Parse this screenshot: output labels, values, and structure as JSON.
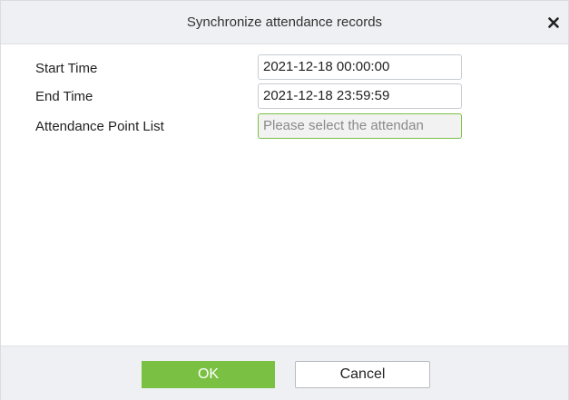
{
  "dialog": {
    "title": "Synchronize attendance records",
    "close_icon": "close-icon"
  },
  "form": {
    "start_time": {
      "label": "Start Time",
      "value": "2021-12-18 00:00:00"
    },
    "end_time": {
      "label": "End Time",
      "value": "2021-12-18 23:59:59"
    },
    "attendance_point_list": {
      "label": "Attendance Point List",
      "placeholder": "Please select the attendan"
    }
  },
  "footer": {
    "ok_label": "OK",
    "cancel_label": "Cancel"
  },
  "colors": {
    "accent": "#7ac143",
    "header_bg": "#eef0f3"
  }
}
